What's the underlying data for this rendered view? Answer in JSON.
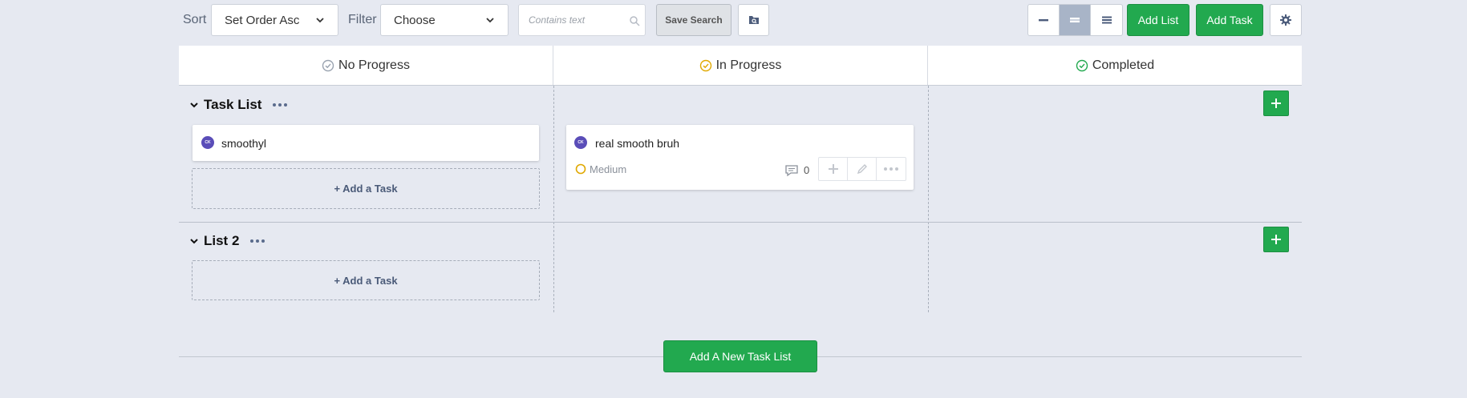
{
  "toolbar": {
    "sort_label": "Sort",
    "sort_value": "Set Order Asc",
    "filter_label": "Filter",
    "filter_value": "Choose",
    "search_placeholder": "Contains text",
    "search_value": "",
    "save_search_label": "Save Search",
    "add_list_label": "Add List",
    "add_task_label": "Add Task",
    "icons": [
      "search-icon",
      "saved-search-icon",
      "view-compact-icon",
      "view-medium-icon",
      "view-expanded-icon",
      "gear-icon"
    ],
    "colors": {
      "green": "#22a94f",
      "active_segment": "#a8b4c7"
    }
  },
  "columns": [
    {
      "label": "No Progress",
      "icon": "check-circle-icon",
      "color": "#9aa3b0"
    },
    {
      "label": "In Progress",
      "icon": "check-circle-icon",
      "color": "#e0a800"
    },
    {
      "label": "Completed",
      "icon": "check-circle-icon",
      "color": "#22a94f"
    }
  ],
  "lists": [
    {
      "title": "Task List",
      "tasks": [
        {
          "title": "smoothyl",
          "avatar": "CK",
          "column": "No Progress"
        },
        {
          "title": "real smooth bruh",
          "avatar": "CK",
          "column": "In Progress",
          "priority": "Medium",
          "comments": "0"
        }
      ],
      "add_task_label": "+ Add a Task"
    },
    {
      "title": "List 2",
      "tasks": [],
      "add_task_label": "+ Add a Task"
    }
  ],
  "footer": {
    "add_new_list_label": "Add A New Task List"
  }
}
